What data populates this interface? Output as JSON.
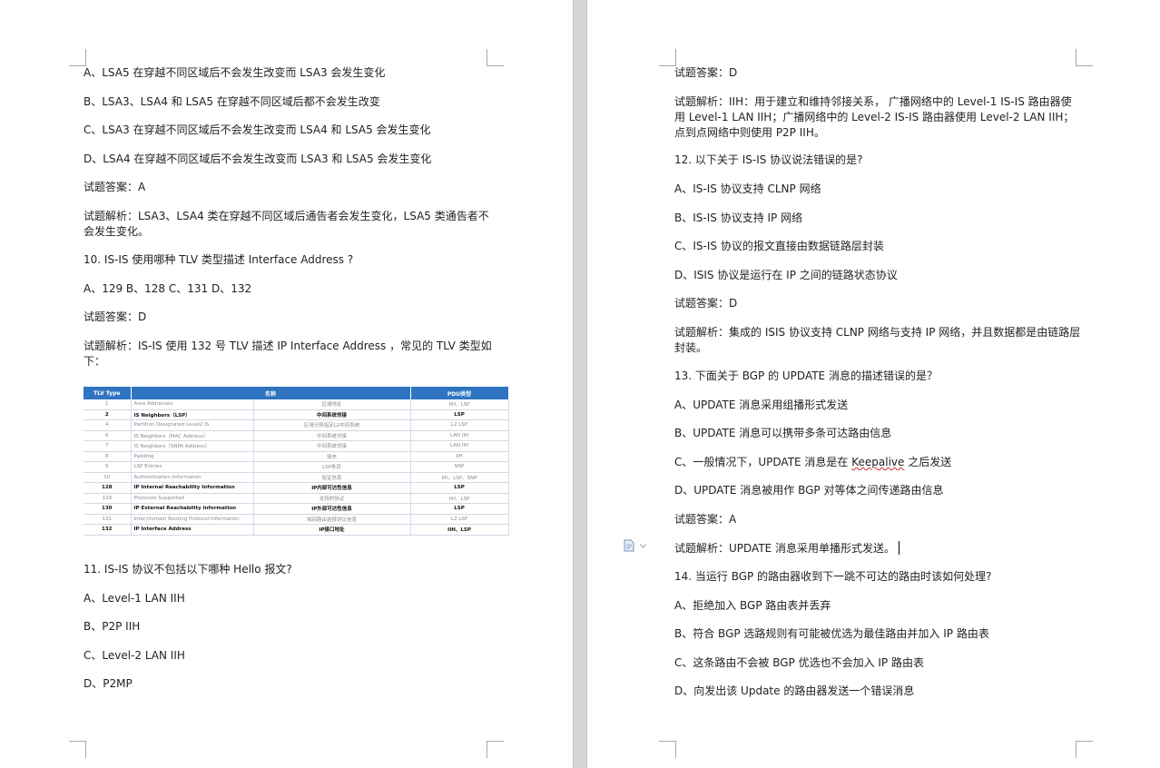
{
  "left_page": {
    "lines": [
      "A、LSA5 在穿越不同区域后不会发生改变而 LSA3 会发生变化",
      "B、LSA3、LSA4 和 LSA5 在穿越不同区域后都不会发生改变",
      "C、LSA3 在穿越不同区域后不会发生改变而 LSA4 和 LSA5 会发生变化",
      "D、LSA4 在穿越不同区域后不会发生改变而 LSA3 和 LSA5 会发生变化",
      "试题答案：A",
      "试题解析：LSA3、LSA4 类在穿越不同区域后通告者会发生变化，LSA5 类通告者不会发生变化。",
      "10. IS-IS 使用哪种 TLV 类型描述 Interface Address ?",
      "A、129  B、128  C、131  D、132",
      "试题答案：D",
      "试题解析：IS-IS 使用 132 号 TLV 描述 IP Interface Address ，常见的 TLV 类型如下：",
      "11. IS-IS 协议不包括以下哪种 Hello 报文?",
      "A、Level-1 LAN IIH",
      "B、P2P IIH",
      "C、Level-2 LAN IIH",
      "D、P2MP"
    ],
    "table": {
      "headers": [
        "TLV Type",
        "名称",
        "PDU类型"
      ],
      "rows": [
        [
          "1",
          "Area Addresses",
          "区域地址",
          "IIH、LSP"
        ],
        [
          "2",
          "IS Neighbors（LSP）",
          "中间系统邻接",
          "LSP"
        ],
        [
          "4",
          "Partition Designated Level2 IS",
          "区域分段指定L2中间系统",
          "L2 LSP"
        ],
        [
          "6",
          "IS Neighbors（MAC Address）",
          "中间系统邻接",
          "LAN IIH"
        ],
        [
          "7",
          "IS Neighbors（SNPA Address）",
          "中间系统邻接",
          "LAN IIH"
        ],
        [
          "8",
          "Padding",
          "填充",
          "IIH"
        ],
        [
          "9",
          "LSP Entries",
          "LSP条目",
          "SNP"
        ],
        [
          "10",
          "Authentication Information",
          "验证信息",
          "IIH、LSP、SNP"
        ],
        [
          "128",
          "IP Internal Reachability Information",
          "IP内部可达性信息",
          "LSP"
        ],
        [
          "129",
          "Protocols Supported",
          "支持的协议",
          "IIH、LSP"
        ],
        [
          "130",
          "IP External Reachability Information",
          "IP外部可达性信息",
          "LSP"
        ],
        [
          "131",
          "Inter-Domain Routing Protocol Information",
          "域间路由选择协议信息",
          "L2 LSP"
        ],
        [
          "132",
          "IP Interface Address",
          "IP接口地址",
          "IIH、LSP"
        ]
      ]
    }
  },
  "right_page": {
    "lines": [
      "试题答案：D",
      "试题解析：IIH：用于建立和维持邻接关系， 广播网络中的 Level-1 IS-IS 路由器使用 Level-1 LAN IIH；广播网络中的 Level-2 IS-IS 路由器使用 Level-2 LAN IIH； 点到点网络中则使用 P2P IIH。",
      "12. 以下关于 IS-IS 协议说法错误的是?",
      "A、IS-IS 协议支持 CLNP 网络",
      "B、IS-IS 协议支持 IP 网络",
      "C、IS-IS 协议的报文直接由数据链路层封装",
      "D、ISIS 协议是运行在 IP 之间的链路状态协议",
      "试题答案：D",
      "试题解析：集成的 ISIS 协议支持 CLNP 网络与支持 IP 网络，并且数据都是由链路层封装。",
      "13. 下面关于 BGP 的 UPDATE 消息的描述错误的是？",
      "A、UPDATE 消息采用组播形式发送",
      "B、UPDATE 消息可以携带多条可达路由信息",
      "C、一般情况下，UPDATE 消息是在 ",
      "Keepalive",
      " 之后发送",
      "D、UPDATE 消息被用作 BGP 对等体之间传递路由信息",
      "试题答案：A",
      "试题解析：UPDATE 消息采用单播形式发送。",
      "14. 当运行 BGP 的路由器收到下一跳不可达的路由时该如何处理?",
      "A、拒绝加入 BGP 路由表并丢弃",
      "B、符合 BGP 选路规则有可能被优选为最佳路由并加入 IP 路由表",
      "C、这条路由不会被 BGP 优选也不会加入 IP 路由表",
      "D、向发出该 Update 的路由器发送一个错误消息"
    ],
    "icons": {
      "comment": "document-comment-icon"
    }
  }
}
